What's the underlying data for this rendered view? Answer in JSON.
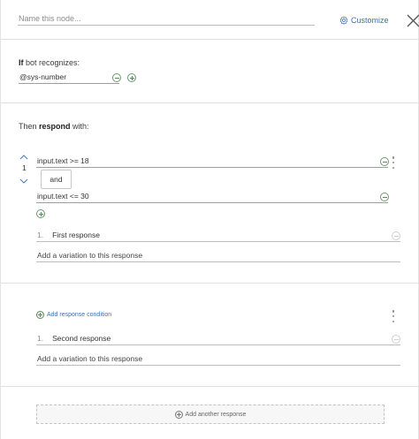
{
  "header": {
    "node_name_placeholder": "Name this node...",
    "customize_label": "Customize"
  },
  "if_section": {
    "label_bold": "If",
    "label_rest": " bot recognizes:",
    "condition": "@sys-number"
  },
  "then_section": {
    "label_pre": "Then ",
    "label_bold": "respond",
    "label_post": " with:"
  },
  "response1": {
    "order": "1",
    "condition1": "input.text >= 18",
    "operator": "and",
    "condition2": "input.text <= 30",
    "number": "1.",
    "text": "First response",
    "variation_placeholder": "Add a variation to this response"
  },
  "response2": {
    "add_condition_label": "Add response condition",
    "number": "1.",
    "text": "Second response",
    "variation_placeholder": "Add a variation to this response"
  },
  "add_response_label": "Add another response",
  "colors": {
    "link_blue": "#3d70b2",
    "add_green": "#5a8a5a",
    "divider": "#e0e0e0"
  },
  "icons": {
    "customize": "gear-icon",
    "close": "close-icon",
    "add": "plus-circle-icon",
    "remove": "minus-circle-icon",
    "move_up": "chevron-up-icon",
    "move_down": "chevron-down-icon",
    "more": "kebab-menu-icon"
  }
}
